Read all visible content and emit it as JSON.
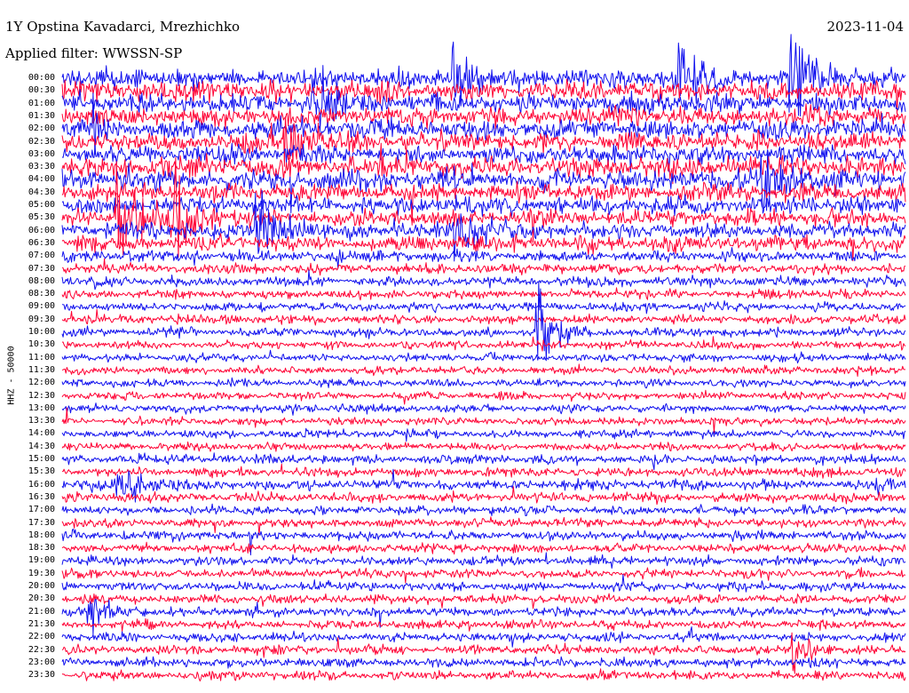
{
  "header": {
    "station": "1Y Opstina Kavadarci, Mrezhichko",
    "date": "2023-11-04",
    "filter": "Applied filter: WWSSN-SP"
  },
  "channel_label": "HHZ - 50000",
  "colors": {
    "trace_a": "#1010ee",
    "trace_b": "#ff0033",
    "background": "#ffffff",
    "text": "#000000"
  },
  "chart_data": {
    "type": "helicorder",
    "date": "2023-11-04",
    "channel": "HHZ - 50000",
    "line_minutes": 30,
    "rows": [
      "00:00",
      "00:30",
      "01:00",
      "01:30",
      "02:00",
      "02:30",
      "03:00",
      "03:30",
      "04:00",
      "04:30",
      "05:00",
      "05:30",
      "06:00",
      "06:30",
      "07:00",
      "07:30",
      "08:00",
      "08:30",
      "09:00",
      "09:30",
      "10:00",
      "10:30",
      "11:00",
      "11:30",
      "12:00",
      "12:30",
      "13:00",
      "13:30",
      "14:00",
      "14:30",
      "15:00",
      "15:30",
      "16:00",
      "16:30",
      "17:00",
      "17:30",
      "18:00",
      "18:30",
      "19:00",
      "19:30",
      "20:00",
      "20:30",
      "21:00",
      "21:30",
      "22:00",
      "22:30",
      "23:00",
      "23:30"
    ],
    "row_colors": [
      "trace_a",
      "trace_b"
    ],
    "noise_level": [
      1.0,
      1.0,
      0.95,
      0.95,
      1.0,
      0.9,
      0.9,
      1.0,
      1.0,
      0.9,
      0.85,
      0.85,
      0.8,
      0.75,
      0.55,
      0.5,
      0.5,
      0.45,
      0.45,
      0.45,
      0.45,
      0.4,
      0.4,
      0.4,
      0.4,
      0.4,
      0.4,
      0.4,
      0.4,
      0.4,
      0.45,
      0.45,
      0.5,
      0.5,
      0.45,
      0.45,
      0.45,
      0.45,
      0.45,
      0.45,
      0.45,
      0.45,
      0.45,
      0.45,
      0.45,
      0.45,
      0.45,
      0.45
    ],
    "events": [
      {
        "row": "00:00",
        "minute": 26,
        "amplitude": 3.0
      },
      {
        "row": "00:00",
        "minute": 14,
        "amplitude": 2.0
      },
      {
        "row": "00:00",
        "minute": 22,
        "amplitude": 2.0
      },
      {
        "row": "01:00",
        "minute": 9,
        "amplitude": 1.8
      },
      {
        "row": "02:30",
        "minute": 8,
        "amplitude": 1.8
      },
      {
        "row": "04:00",
        "minute": 25,
        "amplitude": 2.5
      },
      {
        "row": "05:30",
        "minute": 2,
        "amplitude": 3.0
      },
      {
        "row": "05:30",
        "minute": 4,
        "amplitude": 2.5
      },
      {
        "row": "06:00",
        "minute": 7,
        "amplitude": 2.5
      },
      {
        "row": "06:00",
        "minute": 14,
        "amplitude": 2.0
      },
      {
        "row": "10:00",
        "minute": 17,
        "amplitude": 2.0
      },
      {
        "row": "16:00",
        "minute": 2,
        "amplitude": 1.5
      },
      {
        "row": "21:00",
        "minute": 1,
        "amplitude": 1.2
      },
      {
        "row": "22:30",
        "minute": 26,
        "amplitude": 1.2
      }
    ]
  }
}
